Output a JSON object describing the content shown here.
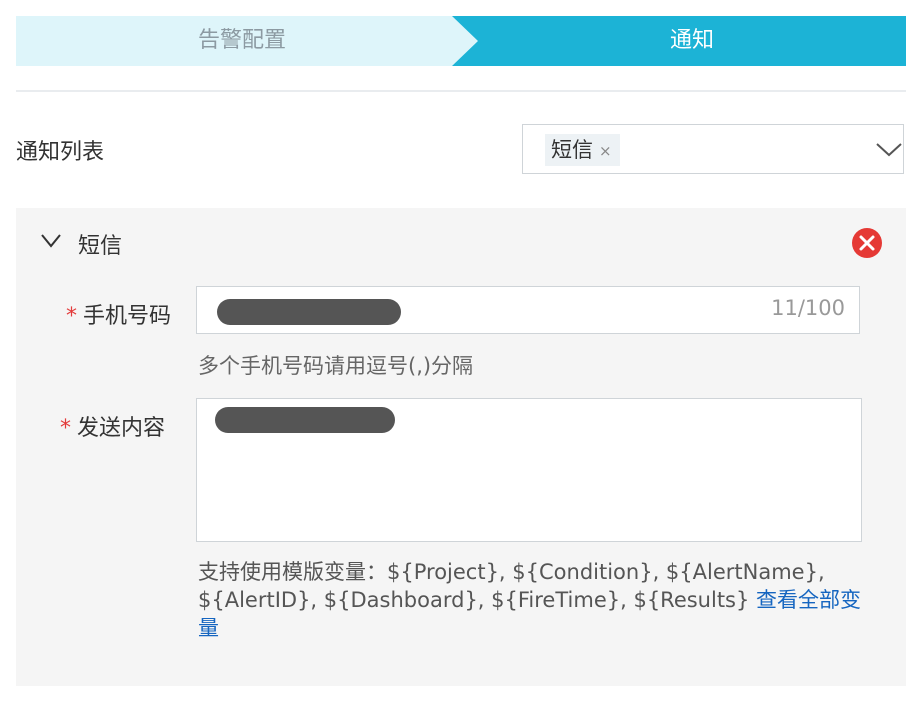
{
  "steps": [
    {
      "label": "告警配置",
      "state": "completed"
    },
    {
      "label": "通知",
      "state": "active"
    }
  ],
  "notify_list": {
    "label": "通知列表",
    "selected_tags": [
      {
        "label": "短信",
        "remove_glyph": "×"
      }
    ],
    "dropdown_icon": "chevron-down-icon"
  },
  "sms_panel": {
    "title": "短信",
    "collapse_icon": "chevron-down-icon",
    "remove_icon": "close-circle-icon",
    "phone": {
      "required_mark": "*",
      "label": "手机号码",
      "counter": "11/100",
      "hint": "多个手机号码请用逗号(,)分隔"
    },
    "content": {
      "required_mark": "*",
      "label": "发送内容",
      "help_text": "支持使用模版变量：${Project}, ${Condition}, ${AlertName}, ${AlertID}, ${Dashboard}, ${FireTime}, ${Results} ",
      "link_label": "查看全部变量"
    }
  },
  "colors": {
    "step_active": "#1cb3d6",
    "step_inactive": "#def5fa",
    "required": "#e33b3b",
    "link": "#1565c0",
    "remove_button": "#e53935"
  }
}
